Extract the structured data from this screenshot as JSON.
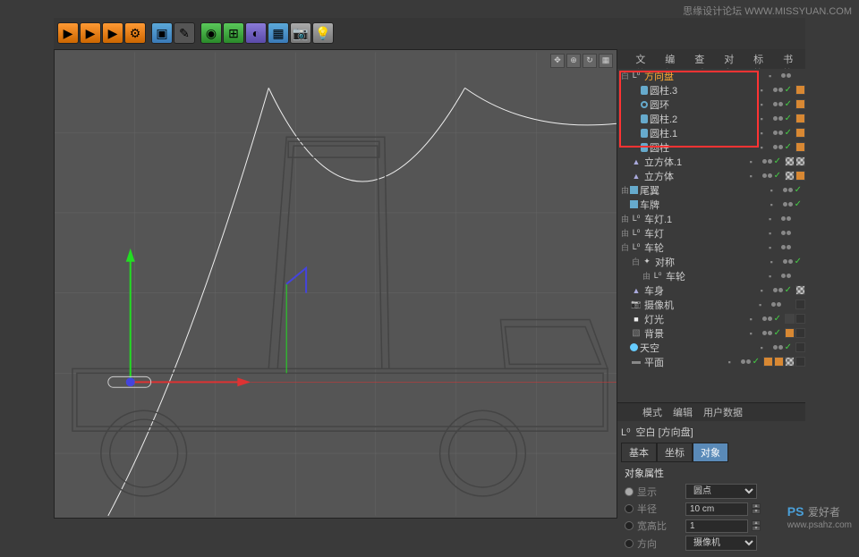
{
  "watermark": {
    "top": "思缘设计论坛  WWW.MISSYUAN.COM",
    "logo": "PS",
    "text": "爱好者",
    "url": "www.psahz.com"
  },
  "panel_tabs": [
    "文件",
    "编辑",
    "查看",
    "对象",
    "标签",
    "书签"
  ],
  "attr_tabs": [
    "模式",
    "编辑",
    "用户数据"
  ],
  "attr_header_prefix": "L⁰",
  "attr_header": "空白 [方向盘]",
  "attr_subtabs": [
    "基本",
    "坐标",
    "对象"
  ],
  "attr_section_title": "对象属性",
  "attr_fields": {
    "display_label": "显示",
    "display_value": "圆点",
    "radius_label": "半径",
    "radius_value": "10 cm",
    "aspect_label": "宽高比",
    "aspect_value": "1",
    "orient_label": "方向",
    "orient_value": "摄像机"
  },
  "objects": [
    {
      "indent": 0,
      "toggle": "白",
      "icon": "null",
      "name": "方向盘",
      "highlight": true,
      "tick": false,
      "tags": []
    },
    {
      "indent": 1,
      "toggle": "",
      "icon": "cyl",
      "name": "圆柱.3",
      "tick": true,
      "tags": [
        "orange"
      ]
    },
    {
      "indent": 1,
      "toggle": "",
      "icon": "ring",
      "name": "圆环",
      "tick": true,
      "tags": [
        "orange"
      ]
    },
    {
      "indent": 1,
      "toggle": "",
      "icon": "cyl",
      "name": "圆柱.2",
      "tick": true,
      "tags": [
        "orange"
      ]
    },
    {
      "indent": 1,
      "toggle": "",
      "icon": "cyl",
      "name": "圆柱.1",
      "tick": true,
      "tags": [
        "orange"
      ]
    },
    {
      "indent": 1,
      "toggle": "",
      "icon": "cyl",
      "name": "圆柱",
      "tick": true,
      "tags": [
        "orange"
      ]
    },
    {
      "indent": 0,
      "toggle": "",
      "icon": "poly",
      "name": "立方体.1",
      "tick": true,
      "tags": [
        "checker",
        "checker"
      ]
    },
    {
      "indent": 0,
      "toggle": "",
      "icon": "poly",
      "name": "立方体",
      "tick": true,
      "tags": [
        "checker",
        "orange"
      ]
    },
    {
      "indent": 0,
      "toggle": "由",
      "icon": "cube",
      "name": "尾翼",
      "tick": true,
      "tags": []
    },
    {
      "indent": 0,
      "toggle": "",
      "icon": "cube",
      "name": "车牌",
      "tick": true,
      "tags": []
    },
    {
      "indent": 0,
      "toggle": "由",
      "icon": "null",
      "name": "车灯.1",
      "tick": false,
      "tags": []
    },
    {
      "indent": 0,
      "toggle": "由",
      "icon": "null",
      "name": "车灯",
      "tick": false,
      "tags": []
    },
    {
      "indent": 0,
      "toggle": "白",
      "icon": "null",
      "name": "车轮",
      "tick": false,
      "tags": []
    },
    {
      "indent": 1,
      "toggle": "白",
      "icon": "sym",
      "name": "对称",
      "tick": true,
      "tags": []
    },
    {
      "indent": 2,
      "toggle": "由",
      "icon": "null",
      "name": "车轮",
      "tick": false,
      "tags": []
    },
    {
      "indent": 0,
      "toggle": "",
      "icon": "poly",
      "name": "车身",
      "tick": true,
      "tags": [
        "checker"
      ]
    },
    {
      "indent": 0,
      "toggle": "",
      "icon": "cam",
      "name": "摄像机",
      "tick": false,
      "tags": [
        "dark"
      ]
    },
    {
      "indent": 0,
      "toggle": "",
      "icon": "light",
      "name": "灯光",
      "tick": true,
      "tags": [
        "x",
        "dark"
      ]
    },
    {
      "indent": 0,
      "toggle": "",
      "icon": "bg",
      "name": "背景",
      "tick": true,
      "tags": [
        "orange",
        "dark"
      ]
    },
    {
      "indent": 0,
      "toggle": "",
      "icon": "sky",
      "name": "天空",
      "tick": true,
      "tags": [
        "dark"
      ]
    },
    {
      "indent": 0,
      "toggle": "",
      "icon": "floor",
      "name": "平面",
      "tick": true,
      "tags": [
        "orange",
        "orange",
        "checker",
        "dark"
      ]
    }
  ]
}
